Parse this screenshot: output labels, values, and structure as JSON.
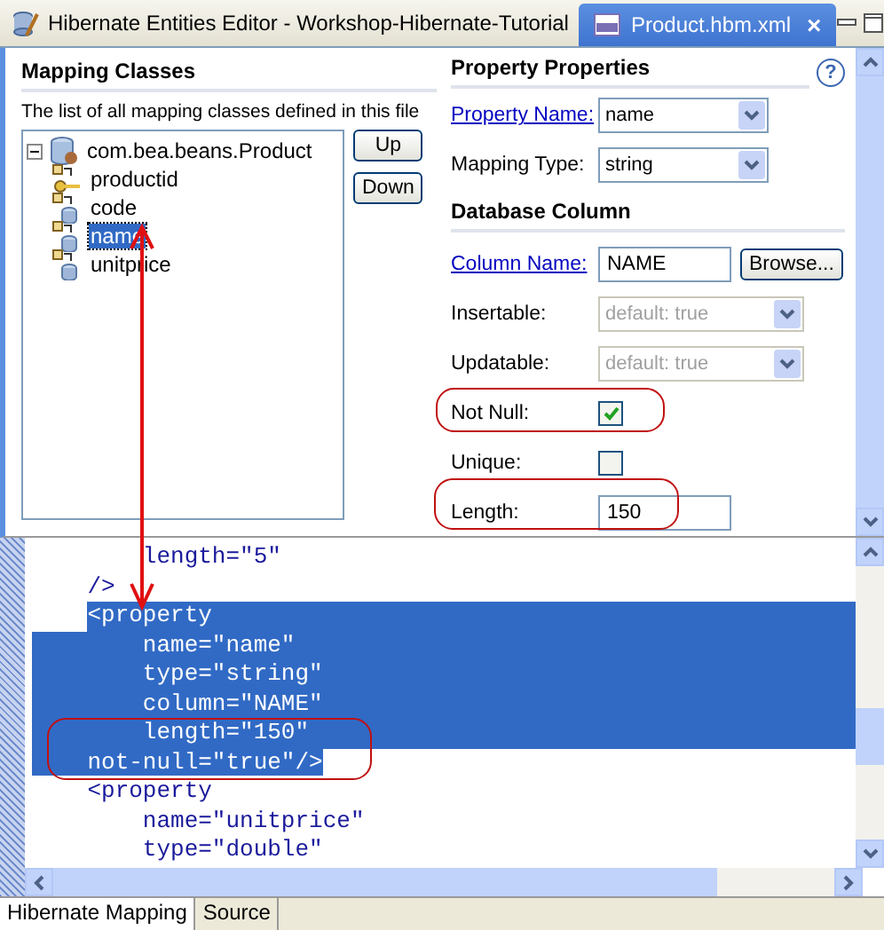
{
  "editor_tabs": [
    {
      "label": "Hibernate Entities Editor - Workshop-Hibernate-Tutorial",
      "selected": false,
      "closable": false
    },
    {
      "label": "Product.hbm.xml",
      "selected": true,
      "closable": true
    }
  ],
  "close_glyph": "×",
  "mapping_classes": {
    "title": "Mapping Classes",
    "description": "The list of all mapping classes defined in this file",
    "tree": [
      {
        "label": "com.bea.beans.Product",
        "kind": "class",
        "expanded": true,
        "selected": false,
        "children": [
          {
            "label": "productid",
            "kind": "id",
            "selected": false
          },
          {
            "label": "code",
            "kind": "property",
            "selected": false
          },
          {
            "label": "name",
            "kind": "property",
            "selected": true
          },
          {
            "label": "unitprice",
            "kind": "property",
            "selected": false
          }
        ]
      }
    ],
    "buttons": [
      "Up",
      "Down"
    ]
  },
  "property_properties": {
    "title": "Property Properties",
    "help": "?",
    "rows": [
      {
        "kind": "combo",
        "label": "Property Name:",
        "link": true,
        "value": "name",
        "disabled": false
      },
      {
        "kind": "combo",
        "label": "Mapping Type:",
        "link": false,
        "value": "string",
        "disabled": false
      },
      {
        "kind": "heading",
        "label": "Database Column"
      },
      {
        "kind": "field",
        "label": "Column Name:",
        "link": true,
        "value": "NAME",
        "button": "Browse..."
      },
      {
        "kind": "combo",
        "label": "Insertable:",
        "link": false,
        "value": "default: true",
        "disabled": true
      },
      {
        "kind": "combo",
        "label": "Updatable:",
        "link": false,
        "value": "default: true",
        "disabled": true
      },
      {
        "kind": "checkbox",
        "label": "Not Null:",
        "link": false,
        "checked": true
      },
      {
        "kind": "checkbox",
        "label": "Unique:",
        "link": false,
        "checked": false
      },
      {
        "kind": "field",
        "label": "Length:",
        "link": false,
        "value": "150"
      }
    ]
  },
  "source": {
    "lines": [
      {
        "text": "        length=\"5\"",
        "selected": false
      },
      {
        "text": "    />",
        "selected": false
      },
      {
        "text": "    <property",
        "selected": true
      },
      {
        "text": "        name=\"name\"",
        "selected": true
      },
      {
        "text": "        type=\"string\"",
        "selected": true
      },
      {
        "text": "        column=\"NAME\"",
        "selected": true
      },
      {
        "text": "        length=\"150\"",
        "selected": true
      },
      {
        "text": "    not-null=\"true\"/>",
        "selected": true
      },
      {
        "text": "    <property",
        "selected": false
      },
      {
        "text": "        name=\"unitprice\"",
        "selected": false
      },
      {
        "text": "        type=\"double\"",
        "selected": false
      }
    ]
  },
  "bottom_tabs": [
    {
      "label": "Hibernate Mapping",
      "selected": true
    },
    {
      "label": "Source",
      "selected": false
    }
  ]
}
